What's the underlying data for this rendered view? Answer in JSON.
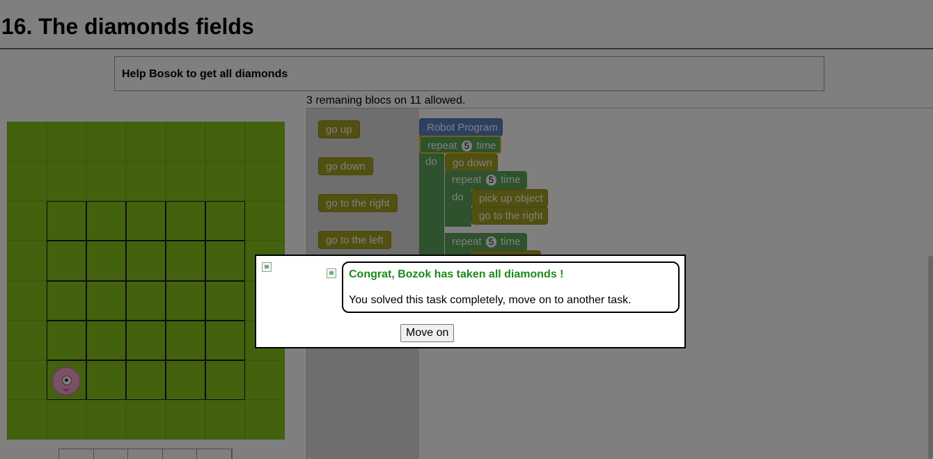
{
  "page": {
    "title": "16. The diamonds fields",
    "instructions": "Help Bosok to get all diamonds",
    "remaining": "3 remaning blocs on 11 allowed."
  },
  "toolbox": {
    "blocks": [
      "go up",
      "go down",
      "go to the right",
      "go to the left"
    ]
  },
  "program": {
    "header": "Robot Program",
    "repeat_word": "repeat",
    "time_word": "time",
    "do_word": "do",
    "outer_count": "5",
    "inner1_count": "5",
    "inner2_count": "5",
    "go_down": "go down",
    "pick_up": "pick up object",
    "go_right": "go to the right"
  },
  "dialog": {
    "title": "Congrat, Bozok has taken all diamonds !",
    "body": "You solved this task completely, move on to another task.",
    "button": "Move on"
  },
  "colors": {
    "grass": "#86c41c",
    "move_block": "#a5a021",
    "loop_block": "#5ba55b",
    "program_block": "#5b80c4",
    "success_text": "#1a8a1a"
  }
}
